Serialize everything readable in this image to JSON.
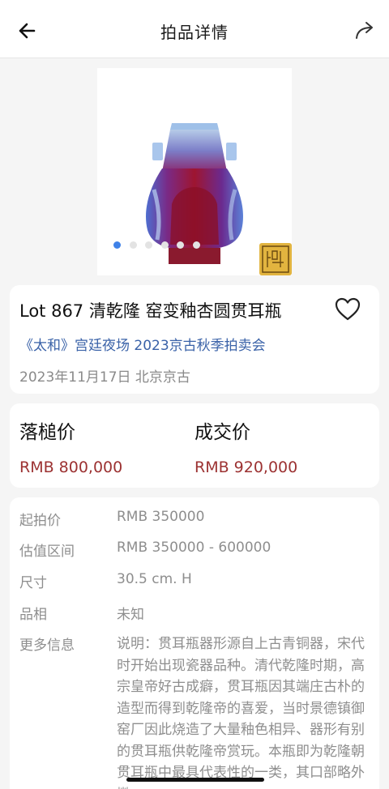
{
  "header": {
    "title": "拍品详情",
    "back_icon": "arrow-left-icon",
    "share_icon": "share-arrow-icon"
  },
  "gallery": {
    "image_count": 6,
    "active_index": 0,
    "accent_color": "#3f82e8"
  },
  "lot": {
    "title": "Lot 867 清乾隆 窑变釉杏圆贯耳瓶",
    "auction": "《太和》宫廷夜场 2023京古秋季拍卖会",
    "date_location": "2023年11月17日 北京京古",
    "favorite_icon": "heart-outline-icon"
  },
  "prices": {
    "hammer_label": "落槌价",
    "hammer_value": "RMB 800,000",
    "final_label": "成交价",
    "final_value": "RMB 920,000",
    "price_color": "#9c3232"
  },
  "info": {
    "rows": [
      {
        "label": "起拍价",
        "value": "RMB 350000"
      },
      {
        "label": "估值区间",
        "value": "RMB 350000 - 600000"
      },
      {
        "label": "尺寸",
        "value": "30.5 cm. H"
      },
      {
        "label": "品相",
        "value": "未知"
      }
    ],
    "more_label": "更多信息",
    "description": "说明：贯耳瓶器形源自上古青铜器，宋代时开始出现瓷器品种。清代乾隆时期，高宗皇帝好古成癖，贯耳瓶因其端庄古朴的造型而得到乾隆帝的喜爱，当时景德镇御窑厂因此烧造了大量釉色相异、器形有别的贯耳瓶供乾隆帝赏玩。本瓶即为乾隆朝贯耳瓶中最具代表性的一类，其口部略外撇"
  }
}
